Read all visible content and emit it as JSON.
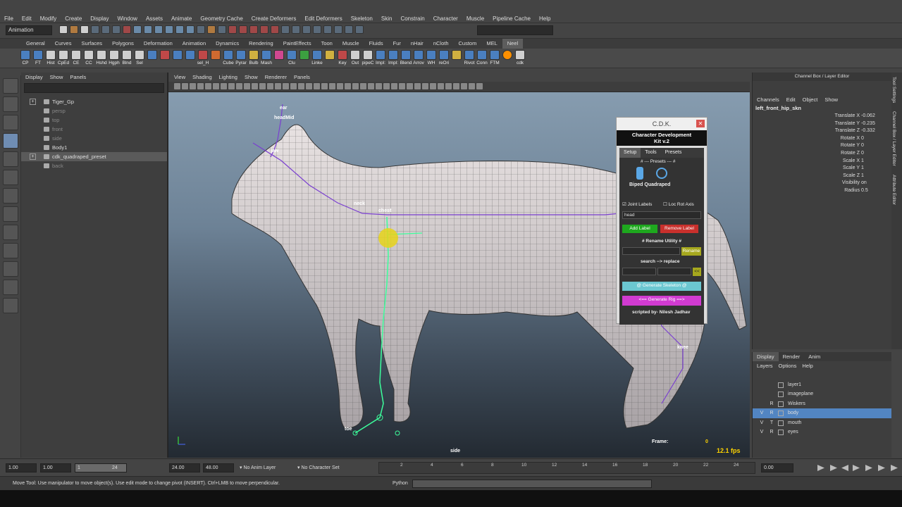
{
  "menubar": {
    "items": [
      "File",
      "Edit",
      "Modify",
      "Create",
      "Display",
      "Window",
      "Assets",
      "Animate",
      "Geometry Cache",
      "Create Deformers",
      "Edit Deformers",
      "Skeleton",
      "Skin",
      "Constrain",
      "Character",
      "Muscle",
      "Pipeline Cache",
      "Help"
    ]
  },
  "statusline": {
    "mode": "Animation"
  },
  "shelf": {
    "tabs": [
      "General",
      "Curves",
      "Surfaces",
      "Polygons",
      "Deformation",
      "Animation",
      "Dynamics",
      "Rendering",
      "PaintEffects",
      "Toon",
      "Muscle",
      "Fluids",
      "Fur",
      "nHair",
      "nCloth",
      "Custom",
      "MEL",
      "Neel"
    ],
    "active_tab": "Neel",
    "items": [
      "CP",
      "FT",
      "Hist",
      "CpEd",
      "CE",
      "CC",
      "Hshd",
      "Hgph",
      "Blnd",
      "Sel",
      "",
      "",
      "",
      "",
      "sel_H",
      "",
      "Cube",
      "Pyrar",
      "Bulb",
      "Mash",
      "",
      "Clu",
      "",
      "Linke",
      "",
      "Key",
      "Out",
      "pipeC",
      "Impl:",
      "Impl:",
      "Blend",
      "Arrov",
      "WH",
      "reOri",
      "",
      "Rivot",
      "Conn",
      "FTM",
      "",
      "cdk"
    ]
  },
  "outliner": {
    "menu": [
      "Display",
      "Show",
      "Panels"
    ],
    "items": [
      {
        "label": "Tiger_Gp",
        "dim": false,
        "expand": "+"
      },
      {
        "label": "persp",
        "dim": true,
        "expand": ""
      },
      {
        "label": "top",
        "dim": true,
        "expand": ""
      },
      {
        "label": "front",
        "dim": true,
        "expand": ""
      },
      {
        "label": "side",
        "dim": true,
        "expand": ""
      },
      {
        "label": "Body1",
        "dim": false,
        "expand": ""
      },
      {
        "label": "cdk_quadraped_preset",
        "dim": false,
        "expand": "+",
        "selected": true
      },
      {
        "label": "back",
        "dim": true,
        "expand": ""
      }
    ]
  },
  "viewport": {
    "menu": [
      "View",
      "Shading",
      "Lighting",
      "Show",
      "Renderer",
      "Panels"
    ],
    "camera_label": "side",
    "frame_label": "Frame:",
    "frame_value": "0",
    "fps": "12.1 fps",
    "joint_labels": [
      "ear",
      "headMid",
      "jaw",
      "neck",
      "chest",
      "toe",
      "knee"
    ]
  },
  "cdk": {
    "title": "C.D.K.",
    "heading_line1": "Character Development",
    "heading_line2": "Kit v.2",
    "tabs": [
      "Setup",
      "Tools",
      "Presets"
    ],
    "presets_label": "# --- Presets --- #",
    "preset_names": "Biped Quadraped",
    "joint_labels_check": "Joint Labels",
    "loc_rot_check": "Loc Rot Axis",
    "label_field": "head",
    "add_label": "Add Label",
    "remove_label": "Remove Label",
    "rename_heading": "# Rename Utility #",
    "rename_btn": "Rename",
    "search_replace": "search  -->  replace",
    "arrow_btn": "<<",
    "generate_skeleton": "@ Generate Skeleton @",
    "generate_rig": "<== Generate Rig ==>",
    "credit": "scripted by- Nilesh Jadhav"
  },
  "channelbox": {
    "header": "Channel Box / Layer Editor",
    "menu": [
      "Channels",
      "Edit",
      "Object",
      "Show"
    ],
    "object": "left_front_hip_skn",
    "attrs": [
      {
        "name": "Translate X",
        "value": "-0.062"
      },
      {
        "name": "Translate Y",
        "value": "-0.235"
      },
      {
        "name": "Translate Z",
        "value": "-0.332"
      },
      {
        "name": "Rotate X",
        "value": "0"
      },
      {
        "name": "Rotate Y",
        "value": "0"
      },
      {
        "name": "Rotate Z",
        "value": "0"
      },
      {
        "name": "Scale X",
        "value": "1"
      },
      {
        "name": "Scale Y",
        "value": "1"
      },
      {
        "name": "Scale Z",
        "value": "1"
      },
      {
        "name": "Visibility",
        "value": "on"
      },
      {
        "name": "Radius",
        "value": "0.5"
      }
    ],
    "side_tabs": [
      "Tool Settings",
      "Channel Box / Layer Editor",
      "Attribute Editor"
    ]
  },
  "layers": {
    "tabs": [
      "Display",
      "Render",
      "Anim"
    ],
    "menu": [
      "Layers",
      "Options",
      "Help"
    ],
    "items": [
      {
        "v1": "",
        "v2": "",
        "name": "layer1"
      },
      {
        "v1": "",
        "v2": "",
        "name": "imageplane"
      },
      {
        "v1": "",
        "v2": "R",
        "name": "Wiskers"
      },
      {
        "v1": "V",
        "v2": "R",
        "name": "body",
        "selected": true
      },
      {
        "v1": "V",
        "v2": "T",
        "name": "mouth"
      },
      {
        "v1": "V",
        "v2": "R",
        "name": "eyes"
      }
    ]
  },
  "timeline": {
    "start": "1.00",
    "start2": "1.00",
    "range_start": "1",
    "range_end": "24",
    "end": "24.00",
    "end2": "48.00",
    "anim_layer": "No Anim Layer",
    "char_set": "No Character Set",
    "current": "0.00",
    "ticks": [
      "2",
      "4",
      "6",
      "8",
      "10",
      "12",
      "14",
      "16",
      "18",
      "20",
      "22",
      "24"
    ]
  },
  "helpline": {
    "text": "Move Tool: Use manipulator to move object(s). Use edit mode to change pivot (INSERT).  Ctrl+LMB to move perpendicular.",
    "python": "Python"
  },
  "colors": {
    "accent": "#5285c2",
    "rig_green": "#3cff9c",
    "joint_purple": "#7a3fd0",
    "gen_skel": "#6bc7d1",
    "gen_rig": "#d13bd1",
    "add_green": "#1ea81e",
    "remove_red": "#c9302c"
  }
}
